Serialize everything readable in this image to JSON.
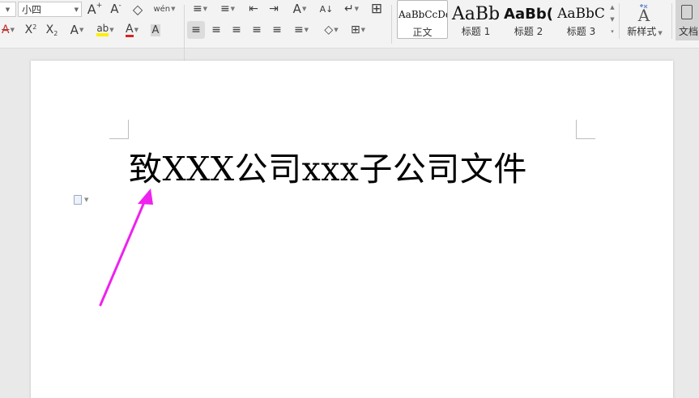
{
  "ribbon": {
    "font_size": "小四",
    "row1": {
      "increase_font": "A",
      "decrease_font": "A",
      "clear_format": "◇",
      "phonetic": "wén",
      "bullets": "≡",
      "numbering": "≡",
      "outdent": "⇤",
      "indent": "⇥",
      "change_case": "A",
      "sort": "A",
      "show_marks": "↵",
      "table_grid": "⊞"
    },
    "row2": {
      "strikethrough": "A",
      "superscript": "X",
      "subscript": "X",
      "text_effect": "A",
      "highlight": "ab",
      "font_color": "A",
      "char_shading": "A",
      "align_left": "≡",
      "align_center": "≡",
      "align_right": "≡",
      "justify": "≡",
      "distribute": "≡",
      "line_spacing": "≡",
      "shading": "◇",
      "borders": "⊞"
    },
    "styles": [
      {
        "preview": "AaBbCcDd",
        "label": "正文"
      },
      {
        "preview": "AaBb",
        "label": "标题 1"
      },
      {
        "preview": "AaBb(",
        "label": "标题 2"
      },
      {
        "preview": "AaBbC",
        "label": "标题 3"
      }
    ],
    "new_style_label": "新样式",
    "doc_tool_label": "文档"
  },
  "document": {
    "title": "致XXX公司xxx子公司文件"
  },
  "colors": {
    "annotation_arrow": "#ee22ee",
    "highlight_yellow": "#ffee00",
    "font_red": "#e02020"
  }
}
